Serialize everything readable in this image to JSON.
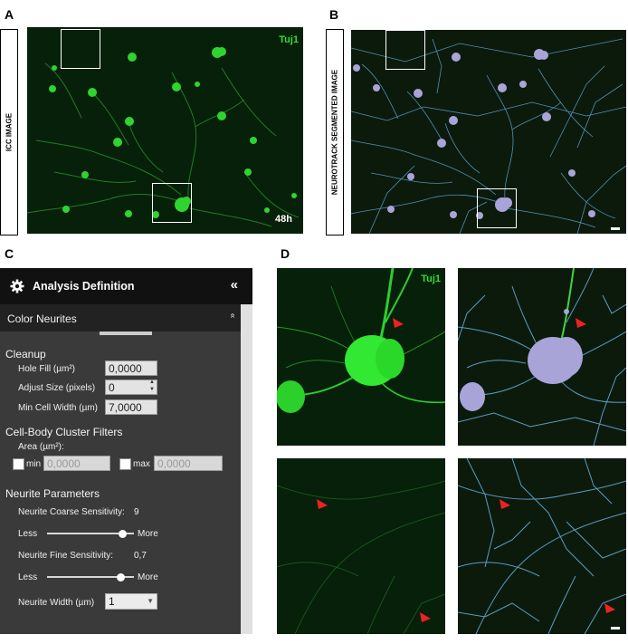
{
  "figure": {
    "panel_labels": {
      "a": "A",
      "b": "B",
      "c": "C",
      "d": "D"
    },
    "a": {
      "side_label": "ICC IMAGE",
      "stain": "Tuj1",
      "timepoint": "48h"
    },
    "b": {
      "side_label": "NEUROTRACK SEGMENTED IMAGE"
    },
    "d": {
      "stain": "Tuj1"
    },
    "colors": {
      "stain": "#33dd33",
      "soma_mask": "#a9a4d8",
      "neurite_mask": "#5a9cc4",
      "arrowhead": "#ee2222",
      "background": "#07200a"
    }
  },
  "analysis": {
    "header": {
      "title": "Analysis Definition",
      "gear_icon": "gear-icon",
      "collapse_glyph": "«"
    },
    "subheader": {
      "title": "Color Neurites",
      "chevron": "«"
    },
    "cleanup": {
      "title": "Cleanup",
      "hole_fill": {
        "label": "Hole Fill (µm²)",
        "value": "0,0000"
      },
      "adjust_size": {
        "label": "Adjust Size (pixels)",
        "value": "0"
      },
      "min_cell_width": {
        "label": "Min Cell Width (µm)",
        "value": "7,0000"
      }
    },
    "cluster": {
      "title": "Cell-Body Cluster Filters",
      "area_label": "Area (µm²):",
      "min": {
        "label": "min",
        "value": "0,0000"
      },
      "max": {
        "label": "max",
        "value": "0,0000"
      }
    },
    "neurite": {
      "title": "Neurite Parameters",
      "coarse": {
        "label": "Neurite Coarse Sensitivity:",
        "value": "9",
        "less": "Less",
        "more": "More",
        "level": 0.87
      },
      "fine": {
        "label": "Neurite Fine Sensitivity:",
        "value": "0,7",
        "less": "Less",
        "more": "More",
        "level": 0.85
      },
      "width": {
        "label": "Neurite Width (µm)",
        "value": "1"
      }
    }
  }
}
